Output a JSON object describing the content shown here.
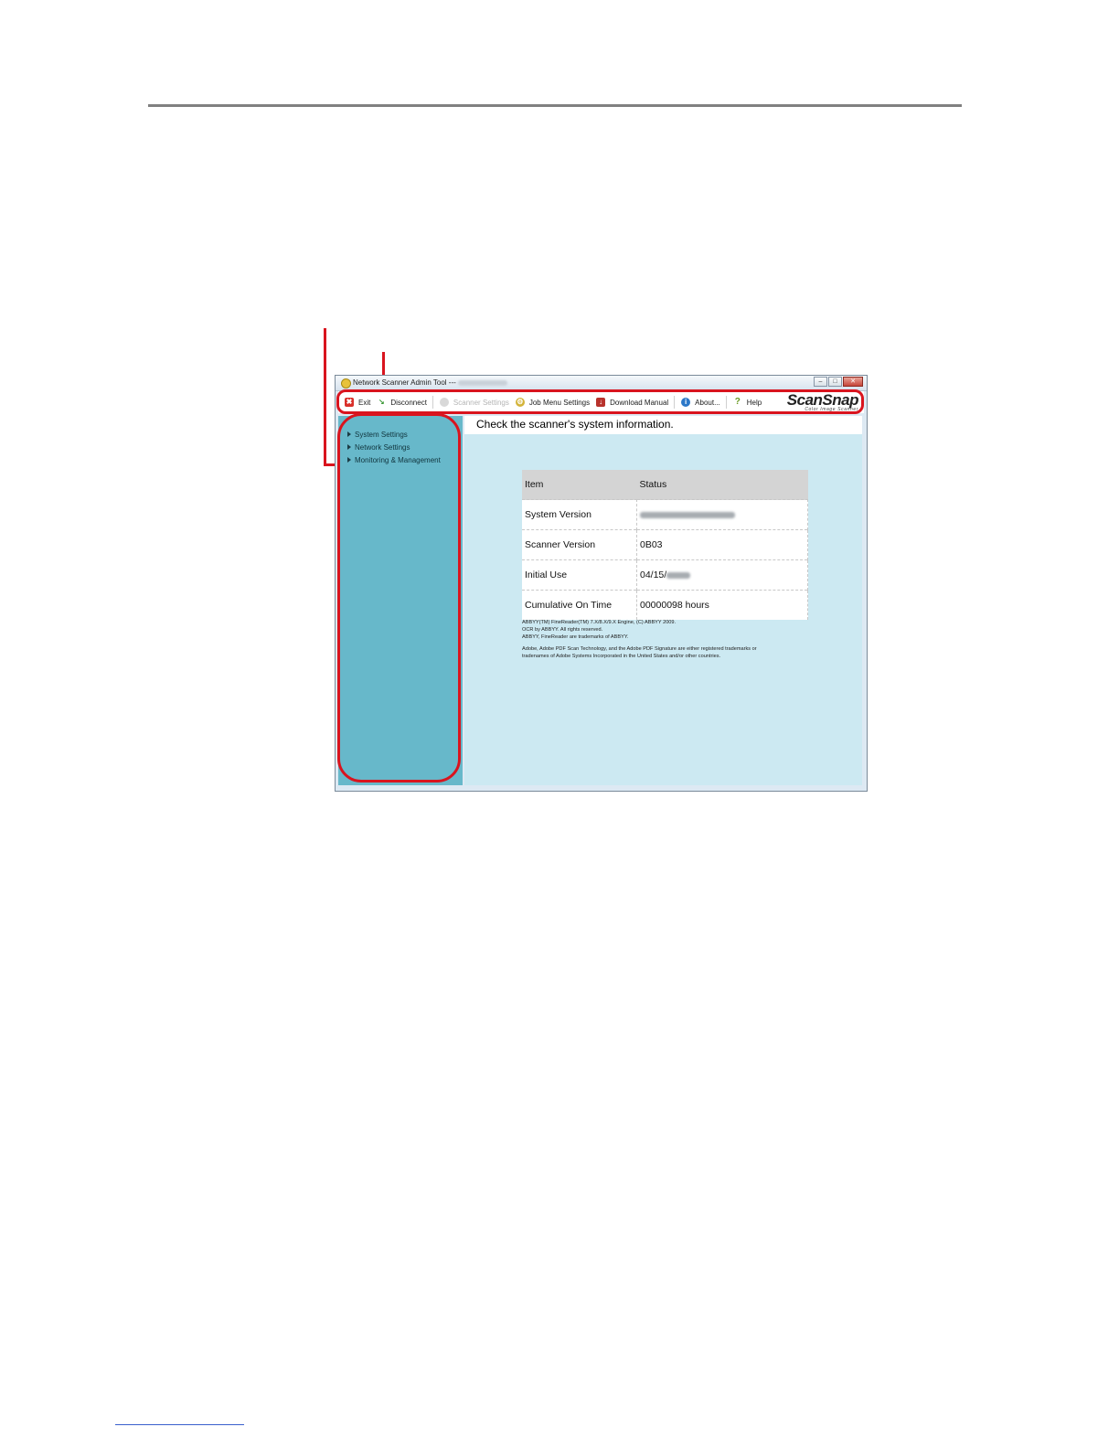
{
  "window": {
    "title": "Network Scanner Admin Tool  ---"
  },
  "toolbar": {
    "items": [
      {
        "label": "Exit",
        "icon": "exit-icon",
        "color": "#d9302a",
        "enabled": true
      },
      {
        "label": "Disconnect",
        "icon": "disconnect-icon",
        "color": "#3f9a3a",
        "enabled": true
      },
      {
        "label": "Scanner Settings",
        "icon": "scanner-settings-icon",
        "color": "#c8c8c8",
        "enabled": false
      },
      {
        "label": "Job Menu Settings",
        "icon": "job-menu-icon",
        "color": "#d3b43a",
        "enabled": true
      },
      {
        "label": "Download Manual",
        "icon": "download-manual-icon",
        "color": "#b8322c",
        "enabled": true
      },
      {
        "label": "About...",
        "icon": "info-icon",
        "color": "#2c78c8",
        "enabled": true
      },
      {
        "label": "Help",
        "icon": "help-icon",
        "color": "#6a9a22",
        "enabled": true
      }
    ],
    "logo_brand": "ScanSnap",
    "logo_tag": "Color Image Scanner"
  },
  "sidebar": {
    "items": [
      {
        "label": "System Settings"
      },
      {
        "label": "Network Settings"
      },
      {
        "label": "Monitoring & Management"
      }
    ]
  },
  "main": {
    "heading": "Check the scanner's system information.",
    "table": {
      "headers": [
        "Item",
        "Status"
      ],
      "rows": [
        {
          "item": "System Version",
          "status": ""
        },
        {
          "item": "Scanner Version",
          "status": "0B03"
        },
        {
          "item": "Initial Use",
          "status": "04/15/"
        },
        {
          "item": "Cumulative On Time",
          "status": "00000098 hours"
        }
      ]
    },
    "notes": [
      "ABBYY(TM) FineReader(TM) 7.X/8.X/9.X Engine, (C) ABBYY 2009.\nOCR by ABBYY. All rights reserved.\nABBYY, FineReader are trademarks of ABBYY.",
      "Adobe, Adobe PDF Scan Technology, and the Adobe PDF Signature are either registered trademarks or\ntradenames of Adobe Systems Incorporated in the United States and/or other countries."
    ]
  },
  "annotations": {
    "color": "#d9141e"
  }
}
